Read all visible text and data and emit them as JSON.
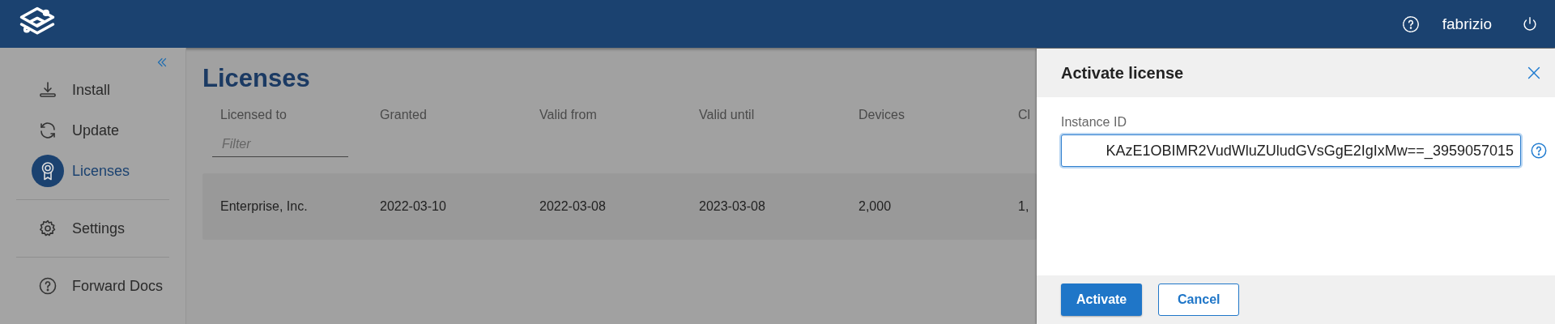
{
  "header": {
    "user": "fabrizio"
  },
  "sidebar": {
    "groups": [
      {
        "items": [
          {
            "label": "Install",
            "selected": false
          },
          {
            "label": "Update",
            "selected": false
          },
          {
            "label": "Licenses",
            "selected": true
          }
        ]
      },
      {
        "items": [
          {
            "label": "Settings",
            "selected": false
          }
        ]
      },
      {
        "items": [
          {
            "label": "Forward Docs",
            "selected": false
          }
        ]
      }
    ]
  },
  "page": {
    "title": "Licenses"
  },
  "table": {
    "columns": [
      "Licensed to",
      "Granted",
      "Valid from",
      "Valid until",
      "Devices",
      "Cl"
    ],
    "filter": {
      "placeholder": "Filter"
    },
    "rows": [
      {
        "cells": [
          "Enterprise, Inc.",
          "2022-03-10",
          "2022-03-08",
          "2023-03-08",
          "2,000",
          "1,"
        ]
      }
    ]
  },
  "drawer": {
    "title": "Activate license",
    "field": {
      "label": "Instance ID",
      "value": "KAzE1OBIMR2VudWluZUludGVsGgE2IgIxMw==_3959057015"
    },
    "buttons": [
      {
        "label": "Activate",
        "kind": "primary"
      },
      {
        "label": "Cancel",
        "kind": "secondary"
      }
    ]
  }
}
